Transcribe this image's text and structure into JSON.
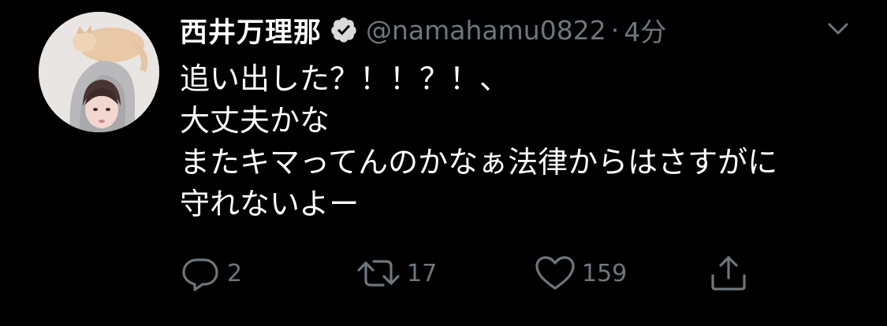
{
  "tweet": {
    "author": {
      "display_name": "西井万理那",
      "handle": "@namahamu0822",
      "verified": true
    },
    "separator": "·",
    "timestamp": "4分",
    "body_lines": [
      "追い出した？！！？！、",
      "大丈夫かな",
      "またキマってんのかなぁ法律からはさすがに",
      "守れないよー"
    ],
    "actions": {
      "reply_count": "2",
      "retweet_count": "17",
      "like_count": "159"
    }
  },
  "icons": {
    "verified": "verified-badge-icon",
    "menu": "chevron-down-icon",
    "reply": "reply-icon",
    "retweet": "retweet-icon",
    "like": "heart-icon",
    "share": "share-icon"
  },
  "colors": {
    "background": "#000000",
    "primary_text": "#ffffff",
    "secondary_text": "#6e767d"
  }
}
